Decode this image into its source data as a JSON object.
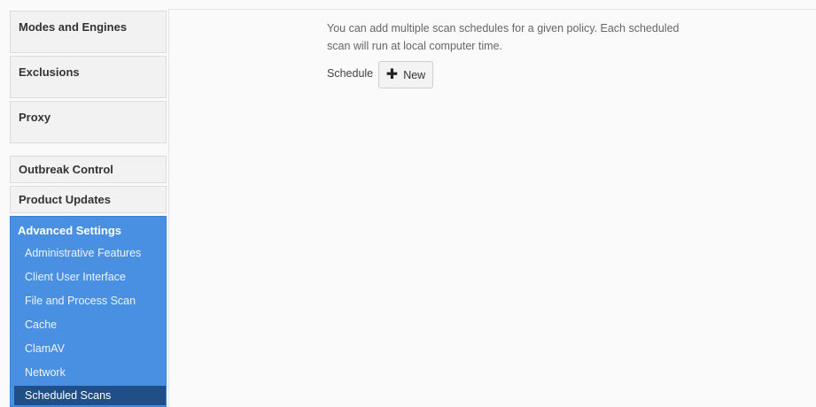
{
  "sidebar": {
    "items": [
      {
        "label": "Modes and Engines"
      },
      {
        "label": "Exclusions"
      },
      {
        "label": "Proxy"
      },
      {
        "label": "Outbreak Control"
      },
      {
        "label": "Product Updates"
      }
    ],
    "advanced": {
      "title": "Advanced Settings",
      "subitems": [
        {
          "label": "Administrative Features"
        },
        {
          "label": "Client User Interface"
        },
        {
          "label": "File and Process Scan"
        },
        {
          "label": "Cache"
        },
        {
          "label": "ClamAV"
        },
        {
          "label": "Network"
        },
        {
          "label": "Scheduled Scans"
        }
      ]
    }
  },
  "main": {
    "info": "You can add multiple scan schedules for a given policy. Each scheduled scan will run at local computer time.",
    "schedule_label": "Schedule",
    "new_button_label": "New"
  },
  "colors": {
    "accent": "#4a90e2",
    "active_item": "#1f4f86"
  },
  "icons": {
    "new_button": "plus-icon"
  }
}
